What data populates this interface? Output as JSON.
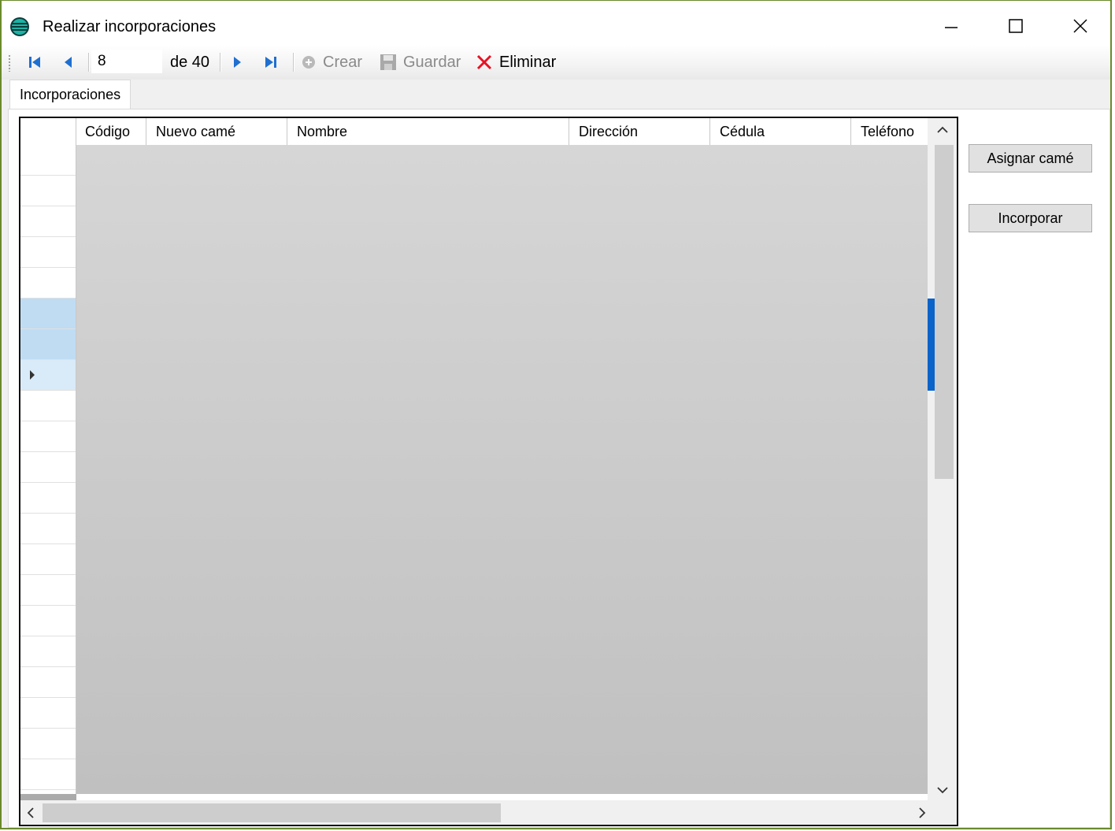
{
  "window": {
    "title": "Realizar incorporaciones",
    "minimize_icon": "minimize-icon",
    "maximize_icon": "maximize-icon",
    "close_icon": "close-icon"
  },
  "navigator": {
    "position": "8",
    "count_label": "de 40",
    "create_label": "Crear",
    "save_label": "Guardar",
    "delete_label": "Eliminar"
  },
  "tabs": [
    {
      "label": "Incorporaciones",
      "selected": true
    }
  ],
  "grid": {
    "columns": [
      "Código",
      "Nuevo camé",
      "Nombre",
      "Dirección",
      "Cédula",
      "Teléfono"
    ],
    "selected_rows": [
      6,
      7
    ],
    "current_row": 8
  },
  "buttons": {
    "assign": "Asignar camé",
    "incorporate": "Incorporar"
  },
  "colors": {
    "selection": "#bfdcf3",
    "accent": "#0a63c9",
    "delete_red": "#e81123"
  }
}
